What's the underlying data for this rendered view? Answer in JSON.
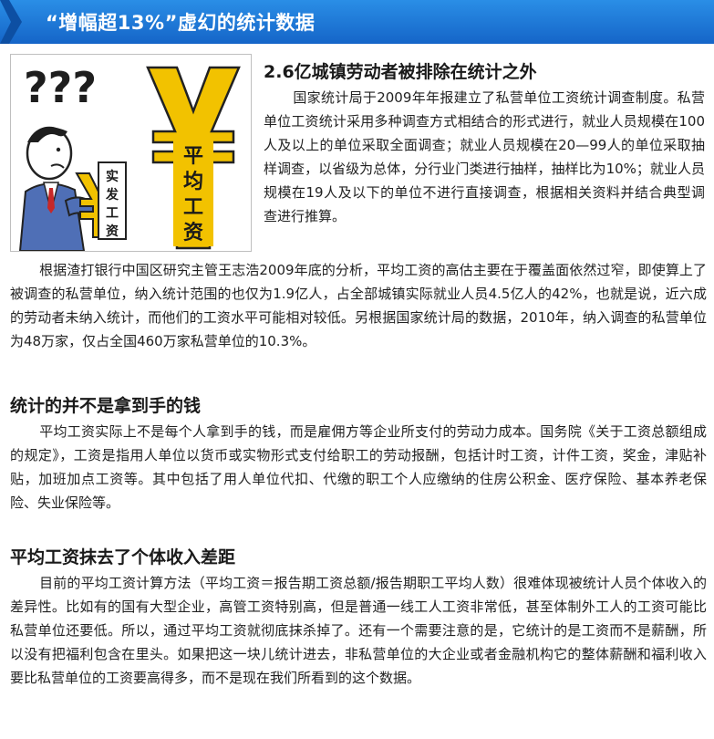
{
  "banner": {
    "title": "“增幅超13%”虚幻的统计数据"
  },
  "illustration": {
    "question_marks": "???",
    "small_sign": "实发工资",
    "big_sign": "平均工资"
  },
  "section1": {
    "heading": "2.6亿城镇劳动者被排除在统计之外",
    "para1": "国家统计局于2009年年报建立了私营单位工资统计调查制度。私营单位工资统计采用多种调查方式相结合的形式进行，就业人员规模在100人及以上的单位采取全面调查；就业人员规模在20—99人的单位采取抽样调查，以省级为总体，分行业门类进行抽样，抽样比为10%；就业人员规模在19人及以下的单位不进行直接调查，根据相关资料并结合典型调查进行推算。",
    "para2": "根据渣打银行中国区研究主管王志浩2009年底的分析，平均工资的高估主要在于覆盖面依然过窄，即使算上了被调查的私营单位，纳入统计范围的也仅为1.9亿人，占全部城镇实际就业人员4.5亿人的42%，也就是说，近六成的劳动者未纳入统计，而他们的工资水平可能相对较低。另根据国家统计局的数据，2010年，纳入调查的私营单位为48万家，仅占全国460万家私营单位的10.3%。"
  },
  "section2": {
    "heading": "统计的并不是拿到手的钱",
    "para": "平均工资实际上不是每个人拿到手的钱，而是雇佣方等企业所支付的劳动力成本。国务院《关于工资总额组成的规定》，工资是指用人单位以货币或实物形式支付给职工的劳动报酬，包括计时工资，计件工资，奖金，津贴补贴，加班加点工资等。其中包括了用人单位代扣、代缴的职工个人应缴纳的住房公积金、医疗保险、基本养老保险、失业保险等。"
  },
  "section3": {
    "heading": "平均工资抹去了个体收入差距",
    "para": "目前的平均工资计算方法（平均工资＝报告期工资总额/报告期职工平均人数）很难体现被统计人员个体收入的差异性。比如有的国有大型企业，高管工资特别高，但是普通一线工人工资非常低，甚至体制外工人的工资可能比私营单位还要低。所以，通过平均工资就彻底抹杀掉了。还有一个需要注意的是，它统计的是工资而不是薪酬，所以没有把福利包含在里头。如果把这一块儿统计进去，非私营单位的大企业或者金融机构它的整体薪酬和福利收入要比私营单位的工资要高得多，而不是现在我们所看到的这个数据。"
  },
  "colors": {
    "banner": "#1a73d6",
    "yuan_gold": "#f2c200",
    "heading_text": "#1a1a1a"
  }
}
